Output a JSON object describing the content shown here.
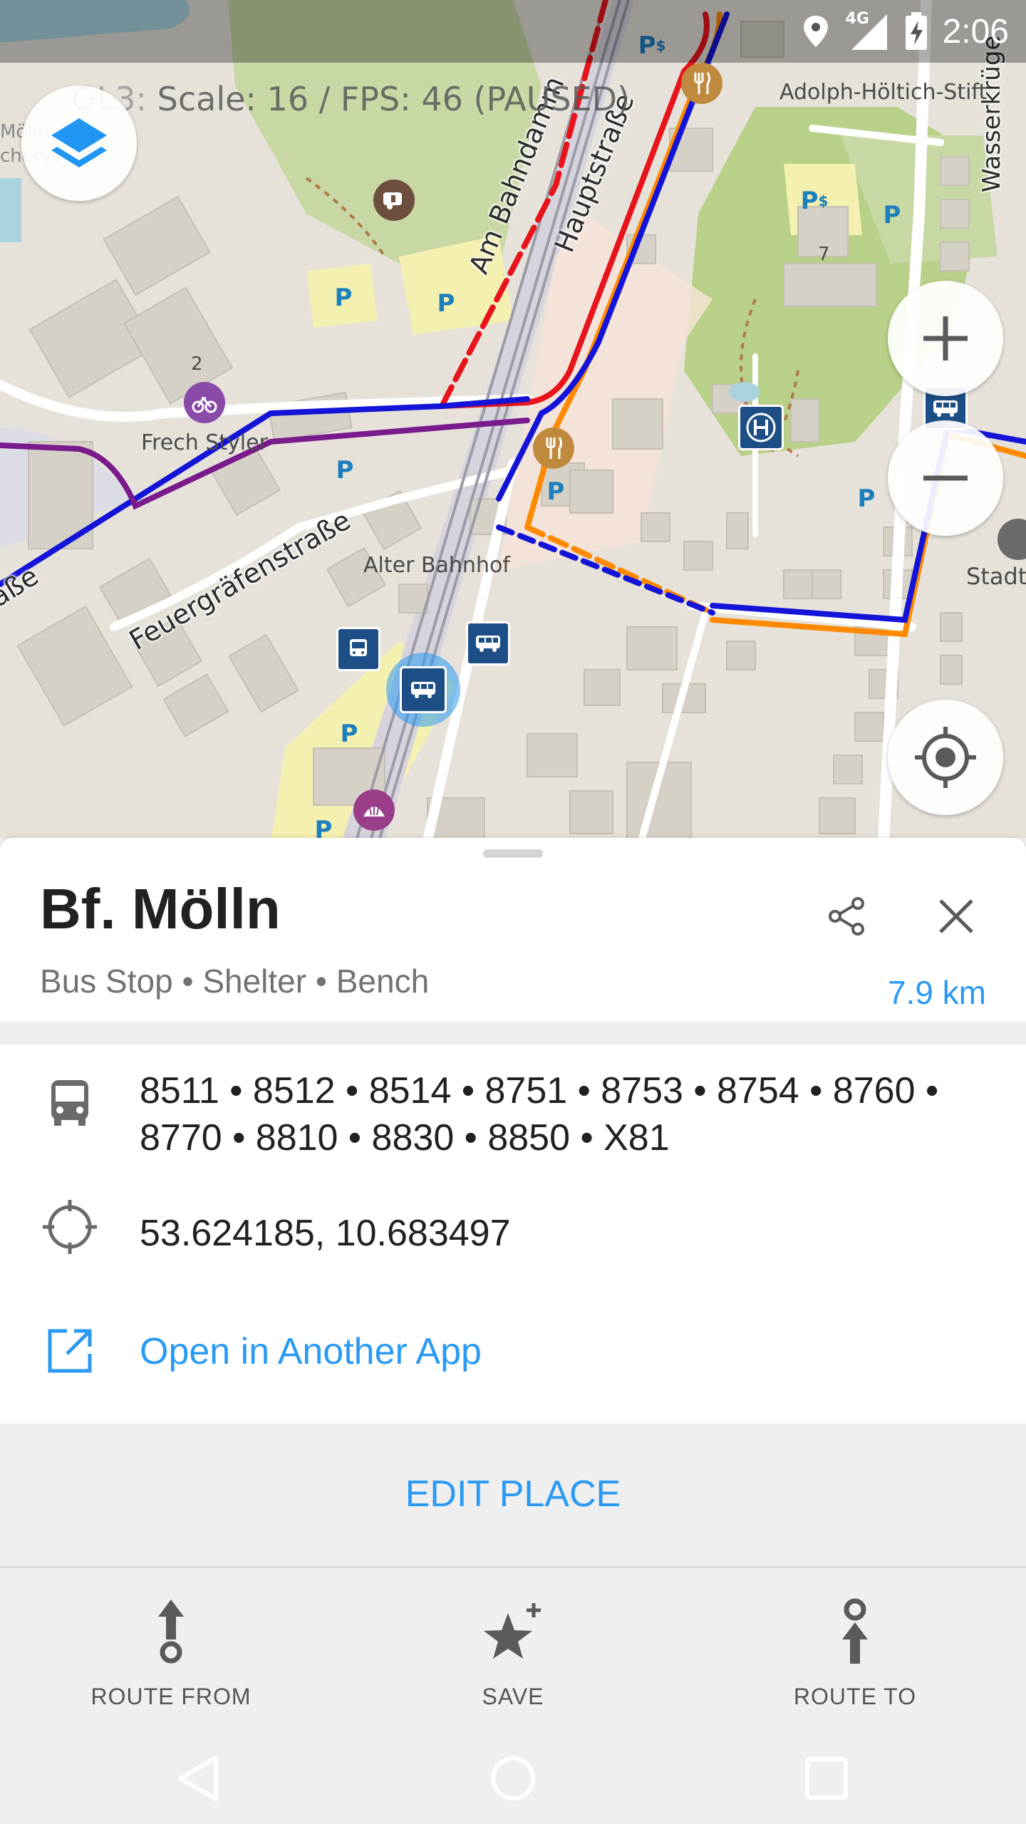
{
  "status_bar": {
    "time": "2:06",
    "network": "4G"
  },
  "map": {
    "debug_overlay": {
      "prefix": "GL3:",
      "text": "Scale: 16 / FPS: 46 (PAUSED)"
    },
    "labels": {
      "adolph": "Adolph-Höltich-Stift",
      "wasser": "Wasserkrüge",
      "frech": "Frech Styler",
      "alter_bahnhof": "Alter Bahnhof",
      "stadt": "Stadth",
      "moelln_a": "Mölln",
      "moelln_b": "cherve e.V.",
      "num_2": "2",
      "num_7": "7"
    },
    "streets": {
      "am_bahndamm": "Am Bahndamm",
      "hauptstrasse": "Hauptstraße",
      "feuergraefen": "Feuergräfenstraße",
      "strasse": "aße"
    },
    "colors": {
      "route_red": "#e8141c",
      "route_orange": "#ff8a00",
      "route_blue": "#1414d8",
      "route_purple": "#7a1a8c",
      "park": "#c8d8a4",
      "building": "#d6d1c7"
    }
  },
  "place": {
    "title": "Bf. Mölln",
    "subtitle": "Bus Stop • Shelter • Bench",
    "distance": "7.9 km"
  },
  "details": {
    "routes_line1": "8511 • 8512 • 8514 • 8751 • 8753 • 8754 • 8760 •",
    "routes_line2": "8770 • 8810 • 8830 • 8850 • X81",
    "coordinates": "53.624185, 10.683497",
    "open_app": "Open in Another App"
  },
  "edit_place": "EDIT PLACE",
  "actions": {
    "route_from": "ROUTE FROM",
    "save": "SAVE",
    "route_to": "ROUTE TO"
  },
  "accent_color": "#2b9af3"
}
